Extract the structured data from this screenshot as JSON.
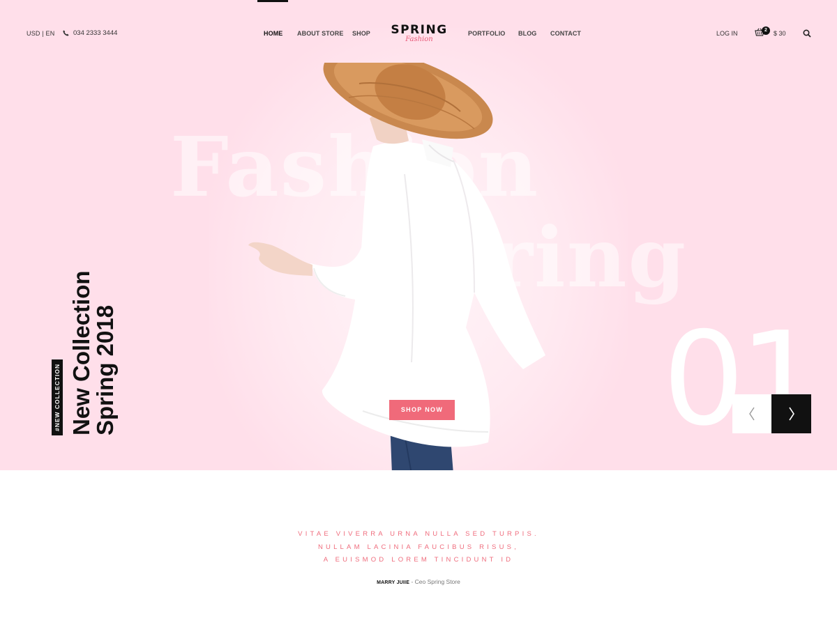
{
  "header": {
    "locale": "USD | EN",
    "phone": "034 2333 3444",
    "nav_left": [
      "HOME",
      "ABOUT STORE",
      "SHOP"
    ],
    "nav_right": [
      "PORTFOLIO",
      "BLOG",
      "CONTACT"
    ],
    "active_nav": "HOME",
    "logo_main": "SPRING",
    "logo_sub": "Fashion",
    "login": "LOG IN",
    "cart_count": "2",
    "cart_total": "$ 30"
  },
  "hero": {
    "bg_word_1": "Fashion",
    "bg_word_2": "Spring",
    "tag": "#NEW COLLECTION",
    "title_line1": "New Collection",
    "title_line2": "Spring 2018",
    "slide_number": "01",
    "cta": "SHOP NOW"
  },
  "quote": {
    "lines": [
      "VITAE VIVERRA URNA NULLA SED TURPIS.",
      "NULLAM LACINIA FAUCIBUS RISUS,",
      "A EUISMOD LOREM TINCIDUNT ID"
    ],
    "author_name": "MARRY JUIIE",
    "author_separator": " - ",
    "author_role": "Ceo Spring Store"
  },
  "colors": {
    "hero_bg": "#ffdfea",
    "accent": "#f06a7a",
    "logo_accent": "#e85a79",
    "dark": "#111111"
  },
  "icons": {
    "phone": "phone-icon",
    "cart": "basket-icon",
    "search": "search-icon",
    "prev": "chevron-left-icon",
    "next": "chevron-right-icon"
  }
}
